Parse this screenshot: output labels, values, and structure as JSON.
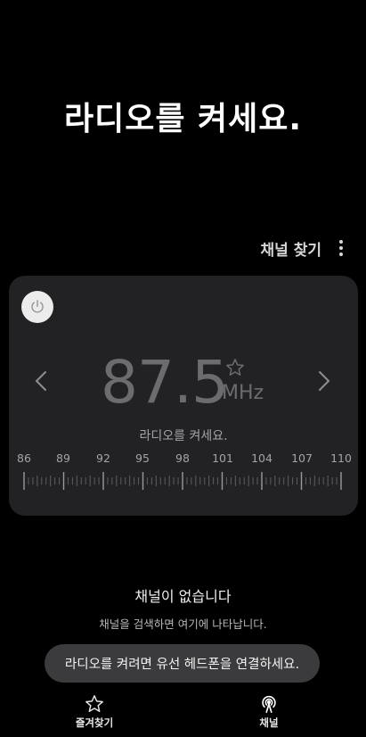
{
  "header": {
    "title": "라디오를 켜세요."
  },
  "toolbar": {
    "search_channels_label": "채널 찾기",
    "more_icon": "more-vertical-icon"
  },
  "tuner": {
    "power_icon": "power-icon",
    "frequency": "87.5",
    "unit": "MHz",
    "status": "라디오를 켜세요.",
    "scale_labels": [
      "86",
      "89",
      "92",
      "95",
      "98",
      "101",
      "104",
      "107",
      "110"
    ],
    "prev_icon": "chevron-left-icon",
    "next_icon": "chevron-right-icon",
    "favorite_icon": "star-outline-icon"
  },
  "empty_state": {
    "title": "채널이 없습니다",
    "description": "채널을 검색하면 여기에 나타납니다."
  },
  "toast": {
    "message": "라디오를 켜려면 유선 헤드폰을 연결하세요."
  },
  "bottom_nav": {
    "items": [
      {
        "label": "즐겨찾기",
        "icon": "star-icon"
      },
      {
        "label": "채널",
        "icon": "radio-antenna-icon"
      }
    ]
  },
  "colors": {
    "background": "#000000",
    "card": "#222224",
    "frequency_text": "#6c6c6e",
    "toast": "#3b3b3d"
  }
}
